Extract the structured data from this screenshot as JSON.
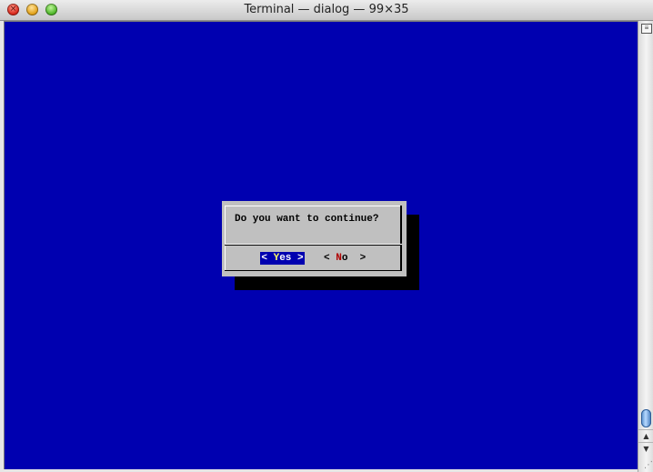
{
  "window": {
    "title": "Terminal — dialog — 99×35",
    "close_glyph": "×",
    "minimize_glyph": "",
    "zoom_glyph": ""
  },
  "dialog": {
    "prompt": "Do you want to continue?",
    "buttons": {
      "yes": {
        "open": "< ",
        "hotkey": "Y",
        "rest": "es",
        "close": " >",
        "selected": true
      },
      "no": {
        "open": "< ",
        "hotkey": "N",
        "rest": "o",
        "close": "  >",
        "selected": false
      }
    }
  },
  "scrollbar": {
    "up_arrow": "▲",
    "down_arrow": "▼",
    "split_icon": "≡",
    "resize_glyph": "⋰"
  },
  "colors": {
    "terminal_background": "#0000b0",
    "dialog_background": "#c0c0c0",
    "selected_button_background": "#0000b0",
    "hotkey_selected": "#ffff66",
    "hotkey_unselected": "#b00000",
    "shadow": "#000000"
  }
}
